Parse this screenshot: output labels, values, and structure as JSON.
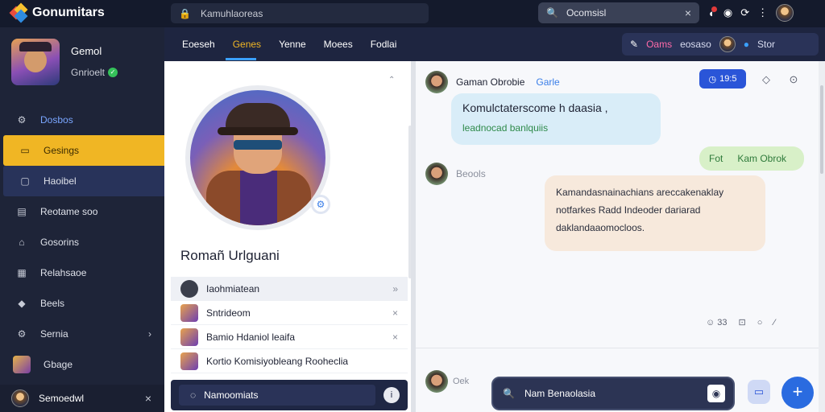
{
  "app": {
    "name": "Gonumitars"
  },
  "topbar": {
    "search_left": "Kamuhlaoreas",
    "search_right": "Ocomsisl"
  },
  "sidebar": {
    "profile": {
      "name": "Gemol",
      "status": "Gnrioelt"
    },
    "items": [
      {
        "label": "Dosbos"
      },
      {
        "label": "Gesings"
      },
      {
        "label": "Haoibel"
      },
      {
        "label": "Reotame soo"
      },
      {
        "label": "Gosorins"
      },
      {
        "label": "Relahsaoe"
      },
      {
        "label": "Beels"
      },
      {
        "label": "Sernia"
      },
      {
        "label": "Gbage"
      }
    ],
    "bottom_user": "Semoedwl"
  },
  "subbar": {
    "tabs": [
      "Eoeseh",
      "Genes",
      "Yenne",
      "Moees",
      "Fodlai"
    ],
    "right_pink": "Oams",
    "right_mid": "eosaso",
    "right_end": "Stor"
  },
  "profile_panel": {
    "name": "Romañ Urlguani",
    "list": [
      {
        "label": "Iaohmiatean",
        "action": "»"
      },
      {
        "label": "Sntrideom",
        "action": "×"
      },
      {
        "label": "Bamio Hdaniol leaifa",
        "action": "×"
      },
      {
        "label": "Kortio Komisiyobleang Rooheclia",
        "action": ""
      }
    ],
    "input_label": "Namoomiats"
  },
  "chat": {
    "header_name": "Gaman Obrobie",
    "header_sub": "Garle",
    "pill_label": "19:5",
    "msg1_line1": "Komulctaterscome h daasia ,",
    "msg1_line2": "leadnocad banlquiis",
    "green_left": "Fot",
    "green_right": "Kam Obrok",
    "sender2": "Beools",
    "msg2_lines": [
      "Kamandasnainachians areccakenaklay",
      "notfarkes Radd Indeoder dariarad",
      "daklandaaomocloos."
    ],
    "reactions": [
      "33",
      "",
      ""
    ],
    "bottom_preview": "Oek",
    "search_placeholder": "Nam Benaolasia"
  }
}
